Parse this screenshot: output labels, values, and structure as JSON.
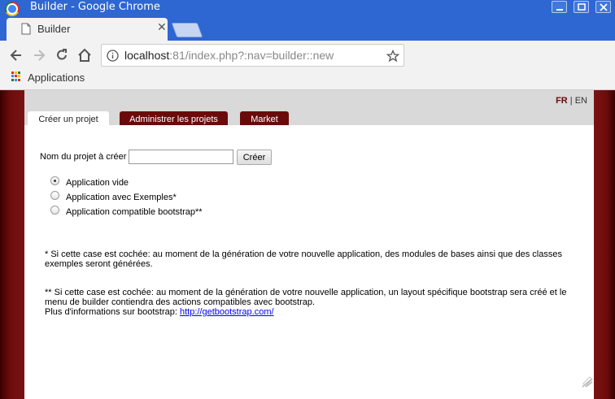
{
  "window": {
    "title": "Builder - Google Chrome"
  },
  "tabs": [
    {
      "label": "Builder",
      "active": true
    }
  ],
  "address_bar": {
    "host": "localhost",
    "path": ":81/index.php?:nav=builder::new"
  },
  "bookmarks": {
    "apps_label": "Applications"
  },
  "page": {
    "lang": {
      "fr": "FR",
      "separator": " | ",
      "en": "EN"
    },
    "tabs": [
      "Créer un projet",
      "Administrer les projets",
      "Market"
    ],
    "form": {
      "label": "Nom du projet à créer",
      "input_value": "",
      "submit_label": "Créer"
    },
    "options": [
      {
        "label": "Application vide",
        "checked": true
      },
      {
        "label": "Application avec Exemples*",
        "checked": false
      },
      {
        "label": "Application compatible bootstrap**",
        "checked": false
      }
    ],
    "note1": "* Si cette case est cochée: au moment de la génération de votre nouvelle application, des modules de bases ainsi que des classes exemples seront générées.",
    "note2": "** Si cette case est cochée: au moment de la génération de votre nouvelle application, un layout spécifique bootstrap sera créé et le menu de builder contiendra des actions compatibles avec bootstrap.",
    "note3_prefix": "Plus d'informations sur bootstrap: ",
    "note3_link": "http://getbootstrap.com/"
  },
  "colors": {
    "titlebar": "#2e66d2",
    "brand_dark_red": "#6a0b0b",
    "page_band": "#d9d9d9"
  }
}
